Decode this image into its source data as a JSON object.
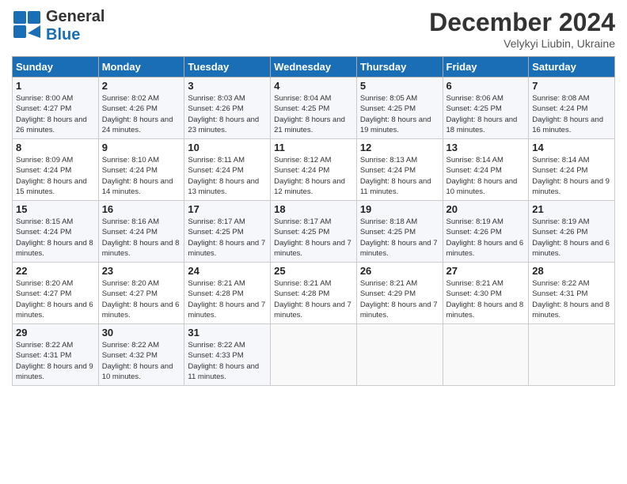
{
  "header": {
    "logo_general": "General",
    "logo_blue": "Blue",
    "month_title": "December 2024",
    "location": "Velykyi Liubin, Ukraine"
  },
  "weekdays": [
    "Sunday",
    "Monday",
    "Tuesday",
    "Wednesday",
    "Thursday",
    "Friday",
    "Saturday"
  ],
  "weeks": [
    [
      {
        "day": "1",
        "sunrise": "8:00 AM",
        "sunset": "4:27 PM",
        "daylight": "8 hours and 26 minutes."
      },
      {
        "day": "2",
        "sunrise": "8:02 AM",
        "sunset": "4:26 PM",
        "daylight": "8 hours and 24 minutes."
      },
      {
        "day": "3",
        "sunrise": "8:03 AM",
        "sunset": "4:26 PM",
        "daylight": "8 hours and 23 minutes."
      },
      {
        "day": "4",
        "sunrise": "8:04 AM",
        "sunset": "4:25 PM",
        "daylight": "8 hours and 21 minutes."
      },
      {
        "day": "5",
        "sunrise": "8:05 AM",
        "sunset": "4:25 PM",
        "daylight": "8 hours and 19 minutes."
      },
      {
        "day": "6",
        "sunrise": "8:06 AM",
        "sunset": "4:25 PM",
        "daylight": "8 hours and 18 minutes."
      },
      {
        "day": "7",
        "sunrise": "8:08 AM",
        "sunset": "4:24 PM",
        "daylight": "8 hours and 16 minutes."
      }
    ],
    [
      {
        "day": "8",
        "sunrise": "8:09 AM",
        "sunset": "4:24 PM",
        "daylight": "8 hours and 15 minutes."
      },
      {
        "day": "9",
        "sunrise": "8:10 AM",
        "sunset": "4:24 PM",
        "daylight": "8 hours and 14 minutes."
      },
      {
        "day": "10",
        "sunrise": "8:11 AM",
        "sunset": "4:24 PM",
        "daylight": "8 hours and 13 minutes."
      },
      {
        "day": "11",
        "sunrise": "8:12 AM",
        "sunset": "4:24 PM",
        "daylight": "8 hours and 12 minutes."
      },
      {
        "day": "12",
        "sunrise": "8:13 AM",
        "sunset": "4:24 PM",
        "daylight": "8 hours and 11 minutes."
      },
      {
        "day": "13",
        "sunrise": "8:14 AM",
        "sunset": "4:24 PM",
        "daylight": "8 hours and 10 minutes."
      },
      {
        "day": "14",
        "sunrise": "8:14 AM",
        "sunset": "4:24 PM",
        "daylight": "8 hours and 9 minutes."
      }
    ],
    [
      {
        "day": "15",
        "sunrise": "8:15 AM",
        "sunset": "4:24 PM",
        "daylight": "8 hours and 8 minutes."
      },
      {
        "day": "16",
        "sunrise": "8:16 AM",
        "sunset": "4:24 PM",
        "daylight": "8 hours and 8 minutes."
      },
      {
        "day": "17",
        "sunrise": "8:17 AM",
        "sunset": "4:25 PM",
        "daylight": "8 hours and 7 minutes."
      },
      {
        "day": "18",
        "sunrise": "8:17 AM",
        "sunset": "4:25 PM",
        "daylight": "8 hours and 7 minutes."
      },
      {
        "day": "19",
        "sunrise": "8:18 AM",
        "sunset": "4:25 PM",
        "daylight": "8 hours and 7 minutes."
      },
      {
        "day": "20",
        "sunrise": "8:19 AM",
        "sunset": "4:26 PM",
        "daylight": "8 hours and 6 minutes."
      },
      {
        "day": "21",
        "sunrise": "8:19 AM",
        "sunset": "4:26 PM",
        "daylight": "8 hours and 6 minutes."
      }
    ],
    [
      {
        "day": "22",
        "sunrise": "8:20 AM",
        "sunset": "4:27 PM",
        "daylight": "8 hours and 6 minutes."
      },
      {
        "day": "23",
        "sunrise": "8:20 AM",
        "sunset": "4:27 PM",
        "daylight": "8 hours and 6 minutes."
      },
      {
        "day": "24",
        "sunrise": "8:21 AM",
        "sunset": "4:28 PM",
        "daylight": "8 hours and 7 minutes."
      },
      {
        "day": "25",
        "sunrise": "8:21 AM",
        "sunset": "4:28 PM",
        "daylight": "8 hours and 7 minutes."
      },
      {
        "day": "26",
        "sunrise": "8:21 AM",
        "sunset": "4:29 PM",
        "daylight": "8 hours and 7 minutes."
      },
      {
        "day": "27",
        "sunrise": "8:21 AM",
        "sunset": "4:30 PM",
        "daylight": "8 hours and 8 minutes."
      },
      {
        "day": "28",
        "sunrise": "8:22 AM",
        "sunset": "4:31 PM",
        "daylight": "8 hours and 8 minutes."
      }
    ],
    [
      {
        "day": "29",
        "sunrise": "8:22 AM",
        "sunset": "4:31 PM",
        "daylight": "8 hours and 9 minutes."
      },
      {
        "day": "30",
        "sunrise": "8:22 AM",
        "sunset": "4:32 PM",
        "daylight": "8 hours and 10 minutes."
      },
      {
        "day": "31",
        "sunrise": "8:22 AM",
        "sunset": "4:33 PM",
        "daylight": "8 hours and 11 minutes."
      },
      null,
      null,
      null,
      null
    ]
  ],
  "labels": {
    "sunrise": "Sunrise:",
    "sunset": "Sunset:",
    "daylight": "Daylight:"
  }
}
